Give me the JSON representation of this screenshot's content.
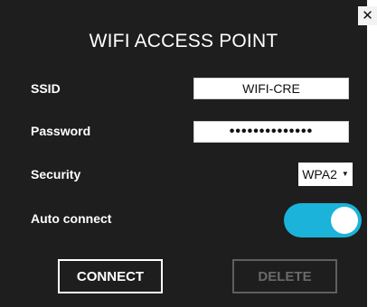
{
  "dialog": {
    "title": "WIFI ACCESS POINT",
    "close_label": "✕"
  },
  "form": {
    "ssid": {
      "label": "SSID",
      "value": "WIFI-CRE"
    },
    "password": {
      "label": "Password",
      "value": "••••••••••••••"
    },
    "security": {
      "label": "Security",
      "selected": "WPA2",
      "caret": "▼"
    },
    "auto_connect": {
      "label": "Auto connect",
      "enabled": true
    }
  },
  "buttons": {
    "connect_label": "CONNECT",
    "delete_label": "DELETE"
  },
  "colors": {
    "dialog_bg": "#1e1e1e",
    "toggle_on": "#1bb3d9",
    "disabled_border": "#5f5f5f"
  }
}
